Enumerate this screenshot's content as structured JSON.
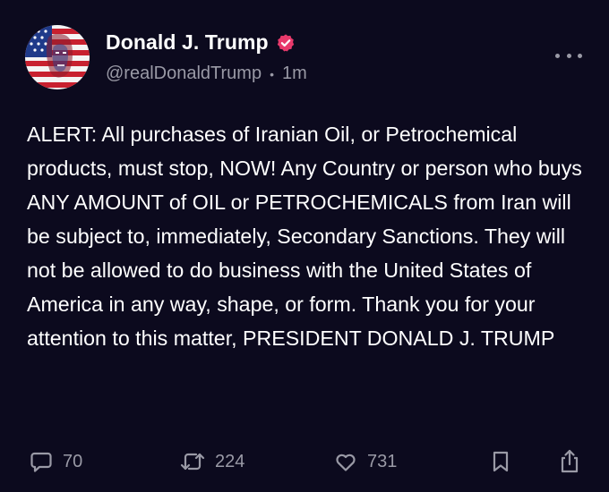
{
  "post": {
    "author": {
      "display_name": "Donald J. Trump",
      "handle": "@realDonaldTrump",
      "verified": true,
      "verified_color": "#e8396b"
    },
    "time_separator": "•",
    "timestamp": "1m",
    "text": "ALERT: All purchases of Iranian Oil, or Petrochemical products, must stop, NOW! Any Country or person who buys ANY AMOUNT of OIL or PETROCHEMICALS from Iran will be subject to, immediately, Secondary Sanctions. They will not be allowed to do business with the United States of America in any way, shape, or form. Thank you for your attention to this matter, PRESIDENT DONALD J. TRUMP",
    "stats": {
      "replies": "70",
      "reposts": "224",
      "likes": "731"
    }
  },
  "icons": {
    "more": "more-horizontal-icon",
    "reply": "speech-bubble-icon",
    "repost": "repost-arrows-icon",
    "like": "heart-icon",
    "bookmark": "bookmark-icon",
    "share": "share-upload-icon"
  },
  "colors": {
    "background": "#0c0a1e",
    "text": "#ffffff",
    "muted": "#9a9aa6"
  }
}
